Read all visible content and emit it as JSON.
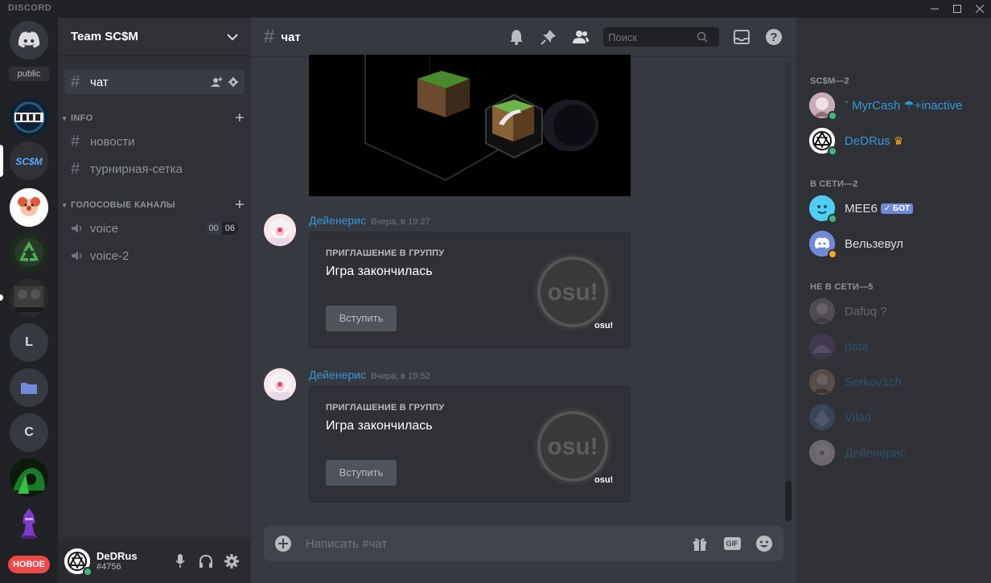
{
  "window": {
    "brand": "DISCORD"
  },
  "guilds": {
    "public_label": "public",
    "letters": [
      "L",
      "C"
    ],
    "new_badge": "НОВОЕ"
  },
  "server": {
    "name": "Team SC$M"
  },
  "channels": {
    "text_active": "чат",
    "category_info": "INFO",
    "info_channels": [
      "новости",
      "турнирная-сетка"
    ],
    "category_voice": "ГОЛОСОВЫЕ КАНАЛЫ",
    "voice_channels": [
      {
        "name": "voice",
        "count_a": "00",
        "count_b": "06"
      },
      {
        "name": "voice-2"
      }
    ]
  },
  "user": {
    "name": "DeDRus",
    "tag": "#4756"
  },
  "chat": {
    "channel": "чат",
    "search_placeholder": "Поиск",
    "composer_placeholder": "Написать #чат",
    "gif_label": "GIF",
    "messages": [
      {
        "author": "Дейенерис",
        "time": "Вчера, в 19:27",
        "invite_title": "ПРИГЛАШЕНИЕ В ГРУППУ",
        "invite_status": "Игра закончилась",
        "join_label": "Вступить",
        "logo_text": "osu!",
        "game": "osu!"
      },
      {
        "author": "Дейенерис",
        "time": "Вчера, в 19:52",
        "invite_title": "ПРИГЛАШЕНИЕ В ГРУППУ",
        "invite_status": "Игра закончилась",
        "join_label": "Вступить",
        "logo_text": "osu!",
        "game": "osu!"
      }
    ]
  },
  "members": {
    "groups": [
      {
        "title": "SC$M—2",
        "members": [
          {
            "name": "ˇ MyrCash ☂+inactive",
            "color": "#3498db"
          },
          {
            "name": "DeDRus",
            "color": "#3498db",
            "crown": "♛"
          }
        ]
      },
      {
        "title": "В СЕТИ—2",
        "members": [
          {
            "name": "MEE6",
            "color": "#dcddde",
            "tag": "✓ БОТ"
          },
          {
            "name": "Вельзевул",
            "color": "#dcddde"
          }
        ]
      },
      {
        "title": "НЕ В СЕТИ—5",
        "members": [
          {
            "name": "Dafuq ?",
            "color": "#dcddde"
          },
          {
            "name": "data",
            "color": "#3498db"
          },
          {
            "name": "Serkov1ch",
            "color": "#3498db"
          },
          {
            "name": "Vilad",
            "color": "#3498db"
          },
          {
            "name": "Дейенерис",
            "color": "#3498db"
          }
        ]
      }
    ]
  },
  "colors": {
    "online": "#43b581",
    "idle": "#faa61a",
    "link": "#3498db",
    "blurple": "#7289da",
    "danger": "#f04747"
  }
}
